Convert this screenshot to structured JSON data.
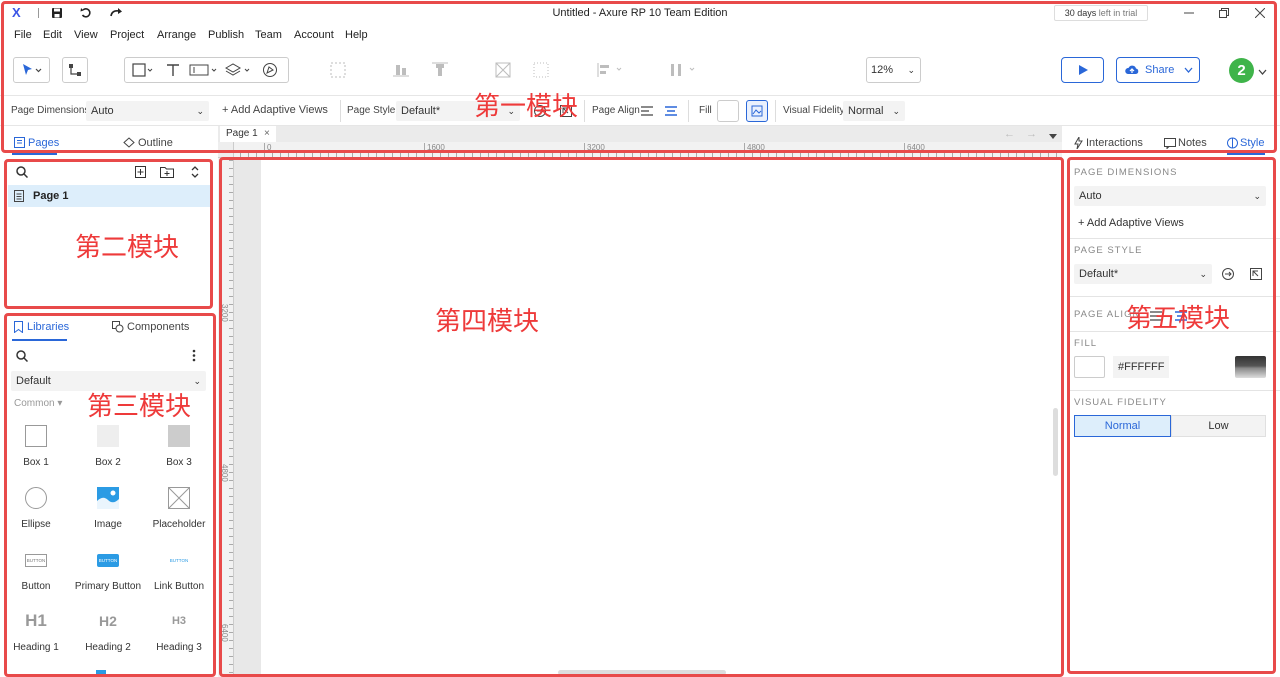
{
  "titlebar": {
    "logo": "X",
    "title": "Untitled - Axure RP 10 Team Edition",
    "trial_days": "30 days",
    "trial_text": "left in trial"
  },
  "menu": [
    "File",
    "Edit",
    "View",
    "Project",
    "Arrange",
    "Publish",
    "Team",
    "Account",
    "Help"
  ],
  "toolbar": {
    "zoom": "12%",
    "share_label": "Share",
    "avatar": "2"
  },
  "stylebar": {
    "page_dimensions_label": "Page Dimensions",
    "page_dimensions_value": "Auto",
    "add_adaptive_views": "+ Add Adaptive Views",
    "page_style_label": "Page Style",
    "page_style_value": "Default*",
    "page_align_label": "Page Align",
    "fill_label": "Fill",
    "visual_fidelity_label": "Visual Fidelity",
    "visual_fidelity_value": "Normal"
  },
  "left_tabs": {
    "pages": "Pages",
    "outline": "Outline"
  },
  "canvas": {
    "page_tab": "Page 1",
    "ruler_h": [
      "0",
      "1600",
      "3200",
      "4800",
      "6400"
    ],
    "ruler_v": [
      "3200",
      "4800",
      "6400"
    ]
  },
  "right_tabs": {
    "interactions": "Interactions",
    "notes": "Notes",
    "style": "Style"
  },
  "pages": {
    "items": [
      "Page 1"
    ]
  },
  "libraries": {
    "tab_libraries": "Libraries",
    "tab_components": "Components",
    "library_select": "Default",
    "category": "Common",
    "items": [
      {
        "label": "Box 1",
        "icon": "box1-icon"
      },
      {
        "label": "Box 2",
        "icon": "box2-icon"
      },
      {
        "label": "Box 3",
        "icon": "box3-icon"
      },
      {
        "label": "Ellipse",
        "icon": "ellipse-icon"
      },
      {
        "label": "Image",
        "icon": "image-icon"
      },
      {
        "label": "Placeholder",
        "icon": "placeholder-icon"
      },
      {
        "label": "Button",
        "icon": "button-icon"
      },
      {
        "label": "Primary Button",
        "icon": "primary-button-icon"
      },
      {
        "label": "Link Button",
        "icon": "link-button-icon"
      },
      {
        "label": "Heading 1",
        "icon": "h1-icon"
      },
      {
        "label": "Heading 2",
        "icon": "h2-icon"
      },
      {
        "label": "Heading 3",
        "icon": "h3-icon"
      }
    ],
    "button_thumb": "BUTTON",
    "h1": "H1",
    "h2": "H2",
    "h3": "H3"
  },
  "style_panel": {
    "page_dimensions": "PAGE DIMENSIONS",
    "dimensions_value": "Auto",
    "add_adaptive_views": "+ Add Adaptive Views",
    "page_style": "PAGE STYLE",
    "page_style_value": "Default*",
    "page_align": "PAGE ALIGN",
    "fill": "FILL",
    "fill_hex": "#FFFFFF",
    "visual_fidelity": "VISUAL FIDELITY",
    "fidelity_normal": "Normal",
    "fidelity_low": "Low"
  },
  "annotations": {
    "module1": "第一模块",
    "module2": "第二模块",
    "module3": "第三模块",
    "module4": "第四模块",
    "module5": "第五模块"
  },
  "colors": {
    "accent": "#2a67d8",
    "annotation_red": "#e84a4a",
    "avatar_green": "#3fb44a"
  }
}
